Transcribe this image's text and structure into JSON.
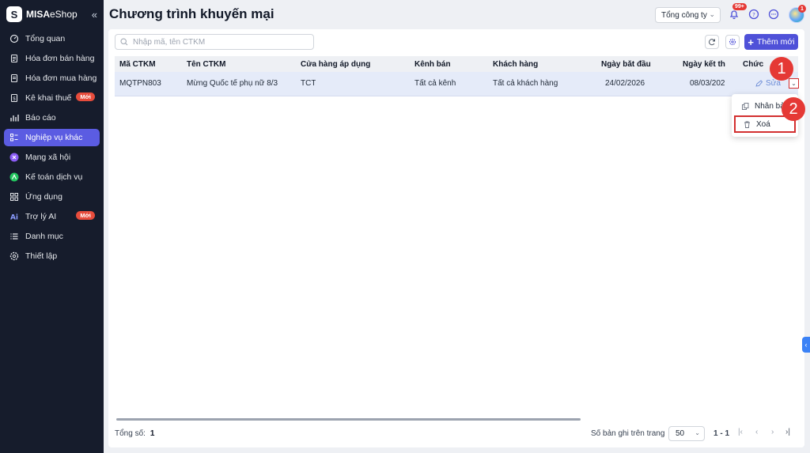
{
  "app": {
    "brand_bold": "MISA",
    "brand_light": "eShop",
    "collapse_icon": "«"
  },
  "sidebar": {
    "items": [
      {
        "label": "Tổng quan",
        "icon": "dashboard-icon"
      },
      {
        "label": "Hóa đơn bán hàng",
        "icon": "invoice-icon"
      },
      {
        "label": "Hóa đơn mua hàng",
        "icon": "purchase-invoice-icon"
      },
      {
        "label": "Kê khai thuế",
        "icon": "tax-icon",
        "badge": "Mới"
      },
      {
        "label": "Báo cáo",
        "icon": "report-icon"
      },
      {
        "label": "Nghiệp vụ khác",
        "icon": "tasks-icon",
        "active": true
      },
      {
        "label": "Mạng xã hội",
        "icon": "social-icon"
      },
      {
        "label": "Kế toán dịch vụ",
        "icon": "accounting-icon"
      },
      {
        "label": "Ứng dụng",
        "icon": "apps-icon"
      },
      {
        "label": "Trợ lý AI",
        "icon": "ai-icon",
        "badge": "Mới"
      },
      {
        "label": "Danh mục",
        "icon": "list-icon"
      },
      {
        "label": "Thiết lập",
        "icon": "settings-icon"
      }
    ]
  },
  "header": {
    "title": "Chương trình khuyến mại",
    "company_select": "Tổng công ty",
    "notification_badge": "99+",
    "avatar_badge": "1"
  },
  "toolbar": {
    "search_placeholder": "Nhập mã, tên CTKM",
    "add_label": "Thêm mới"
  },
  "table": {
    "columns": [
      "Mã CTKM",
      "Tên CTKM",
      "Cửa hàng áp dụng",
      "Kênh bán",
      "Khách hàng",
      "Ngày bắt đầu",
      "Ngày kết thú",
      "Chức"
    ],
    "rows": [
      {
        "code": "MQTPN803",
        "name": "Mừng Quốc tế phụ nữ 8/3",
        "store": "TCT",
        "channel": "Tất cả kênh",
        "customer": "Tất cả khách hàng",
        "start_date": "24/02/2026",
        "end_date": "08/03/202",
        "edit_label": "Sửa"
      }
    ]
  },
  "row_menu": {
    "items": [
      {
        "label": "Nhân bả",
        "icon": "copy-icon"
      },
      {
        "label": "Xoá",
        "icon": "trash-icon"
      }
    ]
  },
  "callouts": [
    "1",
    "2"
  ],
  "footer": {
    "total_label": "Tổng số:",
    "total_value": "1",
    "per_page_label": "Số bản ghi trên trang",
    "per_page_value": "50",
    "range": "1 - 1"
  },
  "colors": {
    "sidebar_bg": "#161c2c",
    "accent": "#5b5ce2",
    "primary_button": "#4f51d8",
    "highlight_red": "#d32f2f",
    "badge_red": "#e74c3c"
  }
}
